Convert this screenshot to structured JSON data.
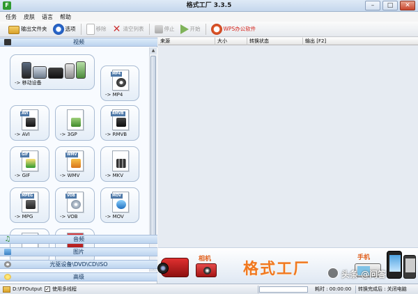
{
  "window": {
    "title": "格式工厂 3.3.5",
    "minimize": "–",
    "maximize": "□",
    "close": "✕"
  },
  "menu": [
    "任务",
    "皮肤",
    "语言",
    "帮助"
  ],
  "toolbar": {
    "output_folder": "输出文件夹",
    "options": "选项",
    "remove": "移除",
    "clear_list": "清空列表",
    "stop": "停止",
    "start": "开始",
    "wps": "WPS办公软件"
  },
  "categories": {
    "video": "视频",
    "audio": "音频",
    "picture": "图片",
    "rom": "光驱设备\\DVD\\CD\\ISO",
    "advanced": "高级"
  },
  "tiles": [
    {
      "label": "-> 移动设备",
      "tag": ""
    },
    {
      "label": "-> MP4",
      "tag": "MP4"
    },
    {
      "label": "-> AVI",
      "tag": "AVI"
    },
    {
      "label": "-> 3GP",
      "tag": ""
    },
    {
      "label": "-> RMVB",
      "tag": "RMVB"
    },
    {
      "label": "-> GIF",
      "tag": "GIF"
    },
    {
      "label": "-> WMV",
      "tag": "WMV"
    },
    {
      "label": "-> MKV",
      "tag": ""
    },
    {
      "label": "-> MPG",
      "tag": "MPEG"
    },
    {
      "label": "-> VOB",
      "tag": "VOB"
    },
    {
      "label": "-> MOV",
      "tag": "MOV"
    }
  ],
  "columns": [
    "来源",
    "大小",
    "转换状态",
    "输出 [F2]"
  ],
  "banner": {
    "title": "格式工厂",
    "camera": "相机",
    "phone": "手机"
  },
  "status": {
    "output_path": "D:\\FFOutput",
    "multithread": "使用多线程",
    "elapsed": "耗时 : 00:00:00",
    "after_done": "转换完成后 : 关闭电脑"
  },
  "watermark": "头条 @问答"
}
